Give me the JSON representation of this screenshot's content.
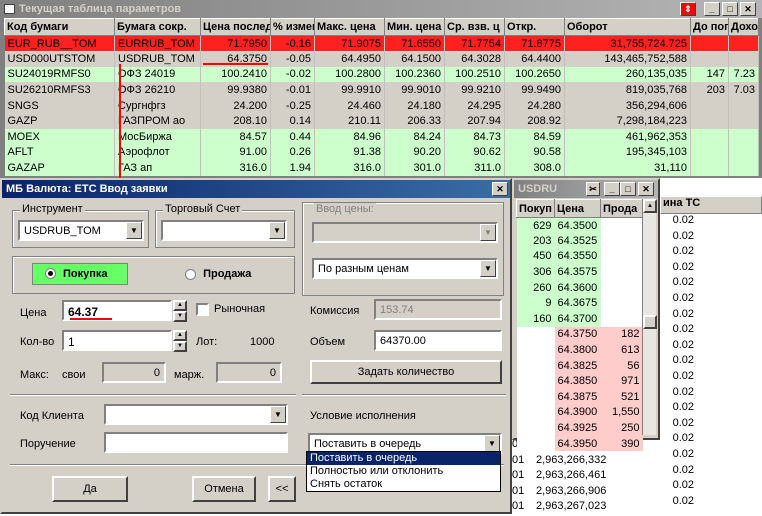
{
  "params_window": {
    "title": "Текущая таблица параметров",
    "columns": [
      "Код бумаги",
      "Бумага сокр.",
      "Цена последн",
      "% измен",
      "Макс. цена",
      "Мин. цена",
      "Ср. взв. ц",
      "Откр.",
      "Оборот",
      "До погаш",
      "Доход"
    ],
    "rows": [
      [
        "EUR_RUB__TOM",
        "EURRUB_TOM",
        "71.7950",
        "-0.16",
        "71.9075",
        "71.6550",
        "71.7754",
        "71.8775",
        "31,755,724.725",
        "",
        ""
      ],
      [
        "USD000UTSTOM",
        "USDRUB_TOM",
        "64.3750",
        "-0.05",
        "64.4950",
        "64.1500",
        "64.3028",
        "64.4400",
        "143,465,752,588",
        "",
        ""
      ],
      [
        "SU24019RMFS0",
        "ОФЗ 24019",
        "100.2410",
        "-0.02",
        "100.2800",
        "100.2360",
        "100.2510",
        "100.2650",
        "260,135,035",
        "147",
        "7.23"
      ],
      [
        "SU26210RMFS3",
        "ОФЗ 26210",
        "99.9380",
        "-0.01",
        "99.9910",
        "99.9010",
        "99.9210",
        "99.9490",
        "819,035,768",
        "203",
        "7.03"
      ],
      [
        "SNGS",
        "Сургнфгз",
        "24.200",
        "-0.25",
        "24.460",
        "24.180",
        "24.295",
        "24.280",
        "356,294,606",
        "",
        ""
      ],
      [
        "GAZP",
        "ГАЗПРОМ ао",
        "208.10",
        "0.14",
        "210.11",
        "206.33",
        "207.94",
        "208.92",
        "7,298,184,223",
        "",
        ""
      ],
      [
        "MOEX",
        "МосБиржа",
        "84.57",
        "0.44",
        "84.96",
        "84.24",
        "84.73",
        "84.59",
        "461,962,353",
        "",
        ""
      ],
      [
        "AFLT",
        "Аэрофлот",
        "91.00",
        "0.26",
        "91.38",
        "90.20",
        "90.62",
        "90.58",
        "195,345,103",
        "",
        ""
      ],
      [
        "GAZAP",
        "ГАЗ ап",
        "316.0",
        "1.94",
        "316.0",
        "301.0",
        "311.0",
        "308.0",
        "31,110",
        "",
        ""
      ]
    ],
    "row_colors": [
      "#ff2020",
      "#d4d0c8",
      "#ccffcc",
      "#d4d0c8",
      "#d4d0c8",
      "#d4d0c8",
      "#ccffcc",
      "#ccffcc",
      "#ccffcc"
    ]
  },
  "order_window": {
    "title": "МБ Валюта: ЕТС Ввод заявки",
    "instrument_label": "Инструмент",
    "instrument_value": "USDRUB_TOM",
    "account_label": "Торговый Счет",
    "account_value": "",
    "price_input_label": "Ввод цены:",
    "price_mode_value": "По разным ценам",
    "buy_label": "Покупка",
    "sell_label": "Продажа",
    "price_label": "Цена",
    "price_value": "64.37",
    "market_label": "Рыночная",
    "qty_label": "Кол-во",
    "qty_value": "1",
    "lot_label": "Лот:",
    "lot_value": "1000",
    "max_label": "Макс:",
    "own_label": "свои",
    "own_value": "0",
    "margin_label": "марж.",
    "margin_value": "0",
    "commission_label": "Комиссия",
    "commission_value": "153.74",
    "volume_label": "Объем",
    "volume_value": "64370.00",
    "set_qty_label": "Задать количество",
    "client_label": "Код Клиента",
    "client_value": "",
    "order_label": "Поручение",
    "order_value": "",
    "exec_label": "Условие исполнения",
    "exec_value": "Поставить в очередь",
    "exec_options": [
      "Поставить в очередь",
      "Полностью или отклонить",
      "Снять остаток"
    ],
    "ok_label": "Да",
    "cancel_label": "Отмена",
    "back_label": "<<"
  },
  "quotes_window": {
    "title": "USDRU",
    "columns": [
      "Покуп",
      "Цена",
      "Прода"
    ],
    "rows": [
      [
        "629",
        "64.3500",
        ""
      ],
      [
        "203",
        "64.3525",
        ""
      ],
      [
        "450",
        "64.3550",
        ""
      ],
      [
        "306",
        "64.3575",
        ""
      ],
      [
        "260",
        "64.3600",
        ""
      ],
      [
        "9",
        "64.3675",
        ""
      ],
      [
        "160",
        "64.3700",
        ""
      ],
      [
        "",
        "64.3750",
        "182"
      ],
      [
        "",
        "64.3800",
        "613"
      ],
      [
        "",
        "64.3825",
        "56"
      ],
      [
        "",
        "64.3850",
        "971"
      ],
      [
        "",
        "64.3875",
        "521"
      ],
      [
        "",
        "64.3900",
        "1,550"
      ],
      [
        "",
        "64.3925",
        "250"
      ],
      [
        "",
        "64.3950",
        "390"
      ]
    ]
  },
  "background_list": {
    "col_header": "ина ТС",
    "step_values": [
      "0.02",
      "0.02",
      "0.02",
      "0.02",
      "0.02",
      "0.02",
      "0.02",
      "0.02",
      "0.02",
      "0.02",
      "0.02",
      "0.02",
      "0.02",
      "0.02",
      "0.02",
      "0.02",
      "0.02",
      "0.02",
      "0.02"
    ],
    "volume_rows": [
      [
        "01",
        "2,963,266,267"
      ],
      [
        "01",
        "2,963,266,332"
      ],
      [
        "01",
        "2,963,266,461"
      ],
      [
        "01",
        "2,963,266,906"
      ],
      [
        "01",
        "2,963,267,023"
      ]
    ]
  },
  "colors": {
    "buy_button": "#66ff66",
    "accent": "#0a246a",
    "highlight_line": "#ff0000"
  }
}
